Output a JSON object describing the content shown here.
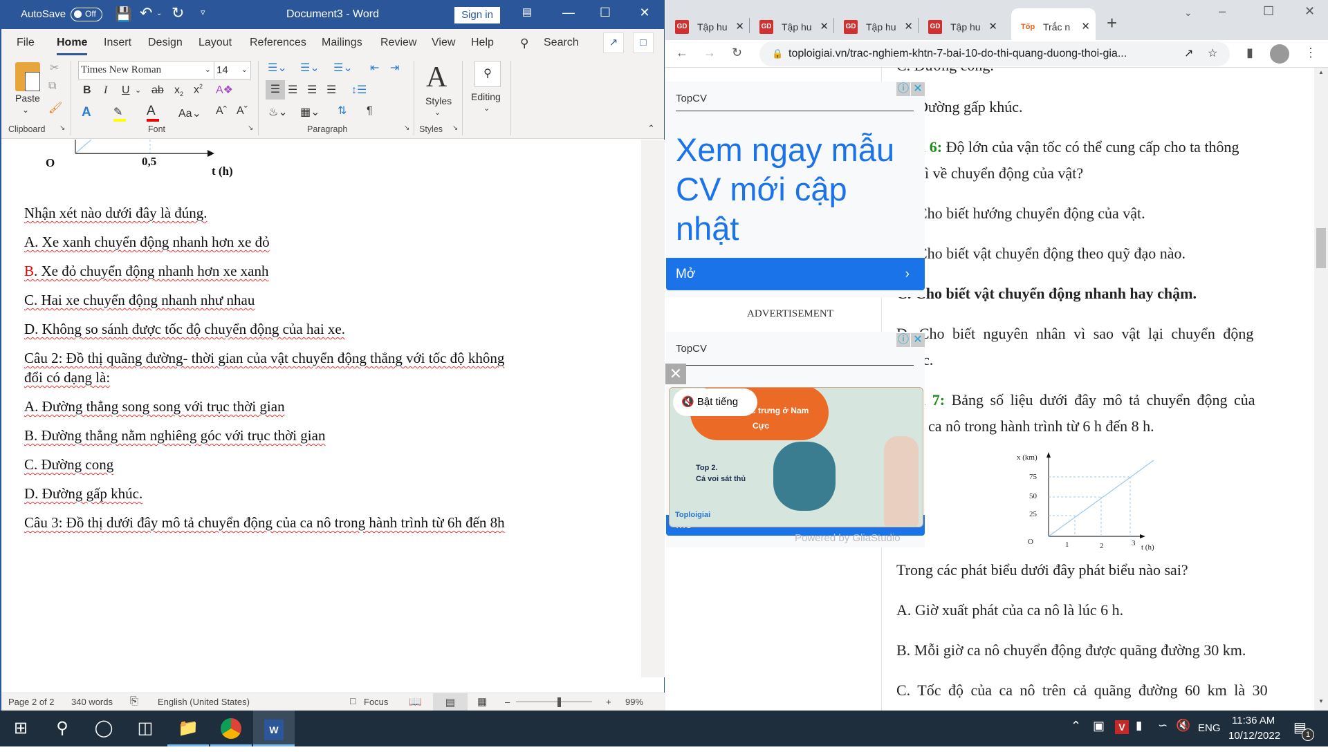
{
  "word": {
    "title": "Document3  -  Word",
    "autosave_label": "AutoSave",
    "autosave_state": "Off",
    "sign_in": "Sign in",
    "tabs": [
      "File",
      "Home",
      "Insert",
      "Design",
      "Layout",
      "References",
      "Mailings",
      "Review",
      "View",
      "Help"
    ],
    "active_tab": "Home",
    "search_label": "Search",
    "ribbon": {
      "paste_label": "Paste",
      "font_name": "Times New Roman",
      "font_size": "14",
      "styles_label": "Styles",
      "editing_label": "Editing",
      "groups": [
        "Clipboard",
        "Font",
        "Paragraph",
        "Styles"
      ]
    },
    "doc": {
      "figure_labels": {
        "origin": "O",
        "tick": "0,5",
        "axis": "t (h)"
      },
      "lines": [
        {
          "text": "Nhận xét nào dưới đây là đúng."
        },
        {
          "text": "A. Xe xanh chuyển động nhanh hơn xe đỏ"
        },
        {
          "prefix": "B",
          "text": ". Xe đỏ chuyển động nhanh hơn xe xanh"
        },
        {
          "text": "C. Hai xe chuyển động nhanh như nhau"
        },
        {
          "text": "D. Không so sánh được tốc độ chuyển động của hai xe."
        },
        {
          "text": "Câu 2: Đồ thị quãng đường- thời gian của vật chuyển động thẳng với tốc độ không"
        },
        {
          "text": "đổi có dạng là:"
        },
        {
          "text": "A. Đường thẳng song song với trục thời gian"
        },
        {
          "text": "B. Đường thẳng nằm nghiêng góc với trục thời gian"
        },
        {
          "text": "C. Đường cong"
        },
        {
          "text": "D. Đường gấp khúc."
        },
        {
          "text": "Câu 3: Đồ thị dưới đây mô tả chuyển động của ca nô trong hành trình từ 6h đến 8h"
        }
      ]
    },
    "status": {
      "page": "Page 2 of 2",
      "words": "340 words",
      "language": "English (United States)",
      "focus": "Focus",
      "zoom": "99%"
    }
  },
  "chrome": {
    "tabs": [
      {
        "label": "Tập hu",
        "favicon": "GD"
      },
      {
        "label": "Tập hu",
        "favicon": "GD"
      },
      {
        "label": "Tập hu",
        "favicon": "GD"
      },
      {
        "label": "Tập hu",
        "favicon": "GD"
      },
      {
        "label": "Trắc n",
        "favicon": "Tốp",
        "active": true
      }
    ],
    "url": "toploigiai.vn/trac-nghiem-khtn-7-bai-10-do-thi-quang-duong-thoi-gia...",
    "ad1": {
      "brand": "TopCV",
      "headline": "Xem ngay mẫu CV mới cập nhật",
      "cta": "Mở",
      "label": "ADVERTISEMENT"
    },
    "ad2": {
      "brand": "TopCV",
      "unmute": "Bật tiếng",
      "video_title": "...g vật đặc trưng ở Nam Cực",
      "video_item": "Top 2.",
      "video_item2": "Cá voi sát thủ",
      "video_brand": "Toploigiai",
      "cta": "Mở",
      "powered": "Powered by GliaStudio"
    },
    "article": {
      "line_c_top": "C. Đường cong.",
      "line_d": "Đường gấp khúc.",
      "q6_label": "u 6:",
      "q6_text": " Độ lớn của vận tốc có thể cung cấp cho ta thông",
      "q6_text2": "gì về chuyển động của vật?",
      "q6_a": "Cho biết hướng chuyển động của vật.",
      "q6_b": "Cho biết vật chuyển động theo quỹ đạo nào.",
      "q6_c": "C. Cho biết vật chuyển động nhanh hay chậm.",
      "q6_d": "D. Cho biết nguyên nhân vì sao vật lại chuyển động",
      "q6_d2": "c.",
      "q7_label": "u 7:",
      "q7_text": " Bảng số liệu dưới đây mô tả chuyển động của",
      "q7_text2": "ca nô trong hành trình từ 6 h đến 8 h.",
      "graph": {
        "ylabel": "x (km)",
        "xlabel": "t (h)",
        "origin": "O",
        "yticks": [
          "75",
          "50",
          "25"
        ],
        "xticks": [
          "1",
          "2",
          "3"
        ]
      },
      "q7_prompt": "Trong các phát biểu dưới đây phát biểu nào sai?",
      "q7_a": "A. Giờ xuất phát của ca nô là lúc 6 h.",
      "q7_b": "B. Mỗi giờ ca nô chuyển động được quãng đường 30 km.",
      "q7_c": "C. Tốc độ của ca nô trên cả quãng đường 60 km là 30"
    }
  },
  "taskbar": {
    "lang": "ENG",
    "time": "11:36 AM",
    "date": "10/12/2022",
    "notifications": "1"
  }
}
